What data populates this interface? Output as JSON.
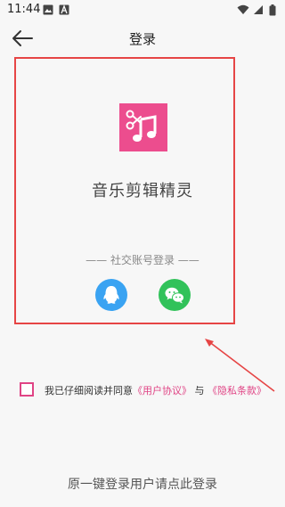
{
  "status_bar": {
    "time": "11:44",
    "left_icons": [
      "image-icon",
      "a-icon"
    ],
    "right_icons": [
      "wifi-icon",
      "signal-icon",
      "battery-icon"
    ]
  },
  "header": {
    "title": "登录",
    "back_icon": "arrow-left-icon"
  },
  "app": {
    "name": "音乐剪辑精灵",
    "logo_icon": "scissors-music-icon",
    "brand_color": "#ec4d8e"
  },
  "social": {
    "label": "—— 社交账号登录 ——",
    "buttons": [
      {
        "icon": "qq-icon",
        "color": "#3aa3f2"
      },
      {
        "icon": "wechat-icon",
        "color": "#31c25a"
      }
    ]
  },
  "agreement": {
    "prefix": "我已仔细阅读并同意",
    "user_agreement": "《用户协议》",
    "connector": "与",
    "privacy_policy": "《隐私条款》"
  },
  "footer": {
    "one_click_login": "原一键登录用户请点此登录"
  },
  "colors": {
    "highlight_border": "#e64545",
    "accent": "#e04485"
  }
}
